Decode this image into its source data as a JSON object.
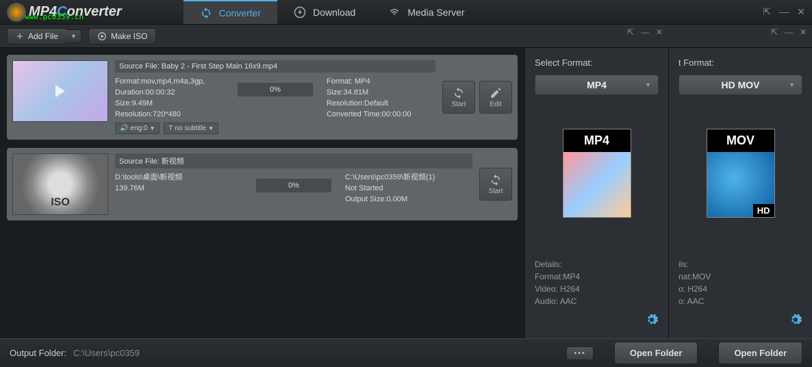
{
  "app": {
    "title_pre": "MP4",
    "title_post": "onverter",
    "watermark": "www.pc0359.cn"
  },
  "tabs": {
    "converter": "Converter",
    "download": "Download",
    "media_server": "Media Server"
  },
  "toolbar": {
    "add_file": "Add File",
    "make_iso": "Make ISO"
  },
  "files": [
    {
      "source_label": "Source File: Baby 2 - First Step Main 16x9.mp4",
      "left": {
        "format": "Format:mov,mp4,m4a,3gp,",
        "duration": "Duration:00:00:32",
        "size": "Size:9.49M",
        "resolution": "Resolution:720*480"
      },
      "right": {
        "format": "Format: MP4",
        "size": "Size:34.81M",
        "resolution": "Resolution:Default",
        "converted": "Converted Time:00:00:00"
      },
      "progress": "0%",
      "audio": "eng:0",
      "subtitle": "no subtitle",
      "actions": {
        "start": "Start",
        "edit": "Edit"
      }
    },
    {
      "source_label": "Source File: 新视频",
      "left_line1": "D:\\tools\\桌面\\新视频",
      "left_line2": "139.76M",
      "right_line1": "C:\\Users\\pc0359\\新视频(1)",
      "right_line2": "Not Started",
      "right_line3": "Output Size:0.00M",
      "progress": "0%",
      "actions": {
        "start": "Start"
      }
    }
  ],
  "panels": [
    {
      "label": "Select Format:",
      "format": "MP4",
      "icon_header": "MP4",
      "details_label": "Details:",
      "details_format": "Format:MP4",
      "details_video": "Video: H264",
      "details_audio": "Audio: AAC"
    },
    {
      "label": "t Format:",
      "format": "HD MOV",
      "icon_header": "MOV",
      "hd": "HD",
      "details_label": "ils:",
      "details_format": "nat:MOV",
      "details_video": "o: H264",
      "details_audio": "o: AAC"
    }
  ],
  "footer": {
    "label": "Output Folder:",
    "path": "C:\\Users\\pc0359",
    "open_folder": "Open Folder"
  }
}
